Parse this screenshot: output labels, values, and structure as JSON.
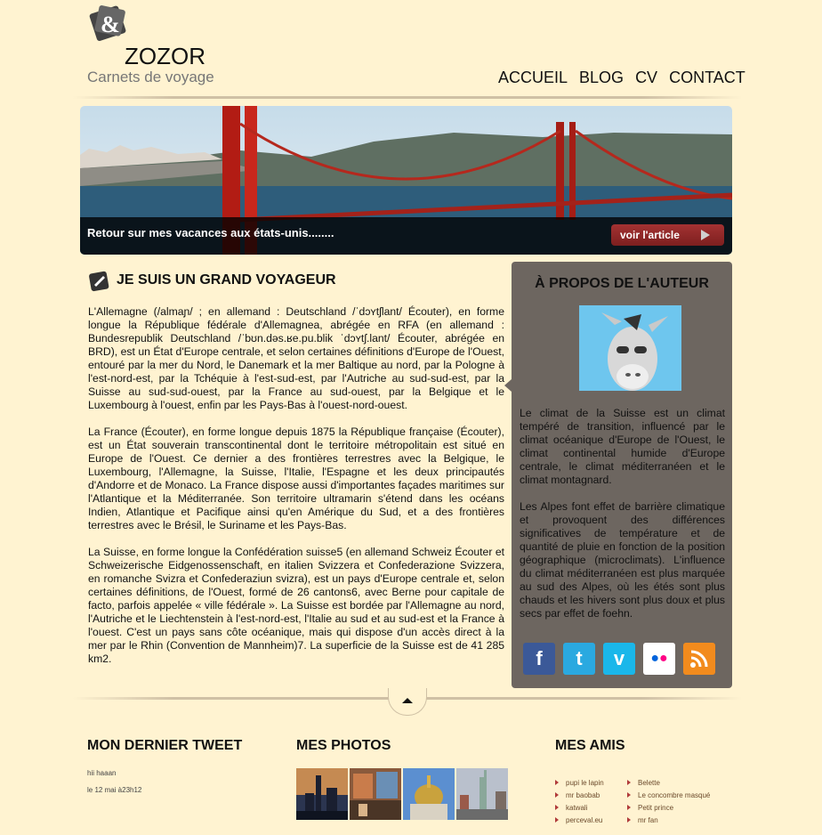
{
  "header": {
    "title": "ZOZOR",
    "subtitle": "Carnets de voyage",
    "nav": [
      "ACCUEIL",
      "BLOG",
      "CV",
      "CONTACT"
    ]
  },
  "banner": {
    "caption": "Retour sur mes vacances aux états-unis........",
    "button_label": "voir l'article"
  },
  "article": {
    "title": "JE SUIS UN GRAND VOYAGEUR",
    "paragraphs": [
      "L'Allemagne (/almaɲ/ ; en allemand : Deutschland /ˈdɔʏtʃlant/ Écouter), en forme longue la République fédérale d'Allemagnea, abrégée en RFA (en allemand : Bundesrepublik Deutschland /ˈbʊn.dəs.ʁe.pu.blik ˈdɔʏtʃ.lant/ Écouter, abrégée en BRD), est un État d'Europe centrale, et selon certaines définitions d'Europe de l'Ouest, entouré par la mer du Nord, le Danemark et la mer Baltique au nord, par la Pologne à l'est-nord-est, par la Tchéquie à l'est-sud-est, par l'Autriche au sud-sud-est, par la Suisse au sud-sud-ouest, par la France au sud-ouest, par la Belgique et le Luxembourg à l'ouest, enfin par les Pays-Bas à l'ouest-nord-ouest.",
      "La France (Écouter), en forme longue depuis 1875 la République française (Écouter), est un État souverain transcontinental dont le territoire métropolitain est situé en Europe de l'Ouest. Ce dernier a des frontières terrestres avec la Belgique, le Luxembourg, l'Allemagne, la Suisse, l'Italie, l'Espagne et les deux principautés d'Andorre et de Monaco. La France dispose aussi d'importantes façades maritimes sur l'Atlantique et la Méditerranée. Son territoire ultramarin s'étend dans les océans Indien, Atlantique et Pacifique ainsi qu'en Amérique du Sud, et a des frontières terrestres avec le Brésil, le Suriname et les Pays-Bas.",
      "La Suisse, en forme longue la Confédération suisse5 (en allemand Schweiz Écouter et Schweizerische Eidgenossenschaft, en italien Svizzera et Confederazione Svizzera, en romanche Svizra et Confederaziun svizra), est un pays d'Europe centrale et, selon certaines définitions, de l'Ouest, formé de 26 cantons6, avec Berne pour capitale de facto, parfois appelée « ville fédérale ». La Suisse est bordée par l'Allemagne au nord, l'Autriche et le Liechtenstein à l'est-nord-est, l'Italie au sud et au sud-est et la France à l'ouest. C'est un pays sans côte océanique, mais qui dispose d'un accès direct à la mer par le Rhin (Convention de Mannheim)7. La superficie de la Suisse est de 41 285 km2."
    ]
  },
  "aside": {
    "title": "À PROPOS DE L'AUTEUR",
    "paragraphs": [
      "Le climat de la Suisse est un climat tempéré de transition, influencé par le climat océanique d'Europe de l'Ouest, le climat continental humide d'Europe centrale, le climat méditerranéen et le climat montagnard.",
      "Les Alpes font effet de barrière climatique et provoquent des différences significatives de température et de quantité de pluie en fonction de la position géographique (microclimats). L'influence du climat méditerranéen est plus marquée au sud des Alpes, où les étés sont plus chauds et les hivers sont plus doux et plus secs par effet de foehn."
    ],
    "social": [
      {
        "icon": "facebook-icon",
        "glyph": "f",
        "color": "#3b5998"
      },
      {
        "icon": "twitter-icon",
        "glyph": "t",
        "color": "#2aa9e0"
      },
      {
        "icon": "vimeo-icon",
        "glyph": "v",
        "color": "#1ab7ea"
      },
      {
        "icon": "flickr-icon",
        "glyph": "••",
        "color": "#ffffff"
      },
      {
        "icon": "rss-icon",
        "glyph": "◔",
        "color": "#f28b1d"
      }
    ]
  },
  "footer": {
    "tweet": {
      "title": "MON DERNIER TWEET",
      "text": "hii haaan",
      "date": "le 12 mai à23h12"
    },
    "photos": {
      "title": "MES PHOTOS",
      "items": [
        "city-skyline-photo",
        "street-market-photo",
        "golden-dome-photo",
        "liberty-statue-photo"
      ]
    },
    "friends": {
      "title": "MES AMIS",
      "col1": [
        "pupi le lapin",
        "mr baobab",
        "katwali",
        "perceval.eu"
      ],
      "col2": [
        "Belette",
        "Le concombre masqué",
        "Petit prince",
        "mr fan"
      ]
    }
  }
}
